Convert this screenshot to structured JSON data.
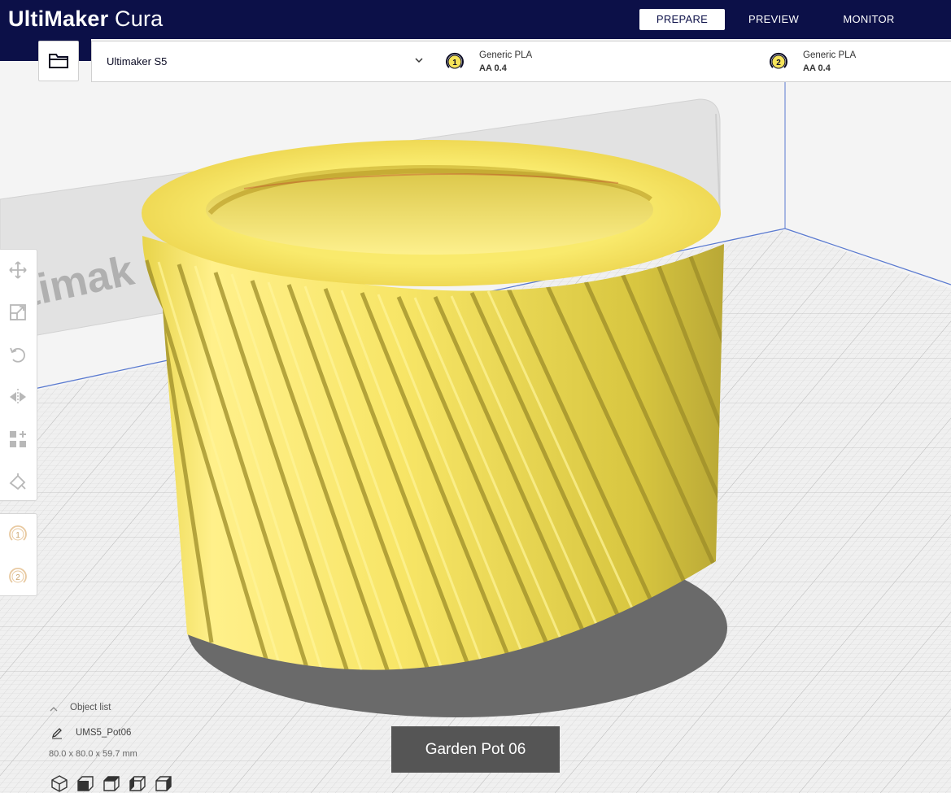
{
  "app": {
    "logo_bold": "UltiMaker",
    "logo_light": " Cura",
    "brand_color": "#0c1048"
  },
  "stages": {
    "prepare": "PREPARE",
    "preview": "PREVIEW",
    "monitor": "MONITOR",
    "active": "PREPARE"
  },
  "header": {
    "open_file_icon": "folder-icon",
    "printer": "Ultimaker S5",
    "extruders": [
      {
        "number": "1",
        "material": "Generic PLA",
        "core": "AA 0.4"
      },
      {
        "number": "2",
        "material": "Generic PLA",
        "core": "AA 0.4"
      }
    ]
  },
  "tools": [
    {
      "icon": "move-icon"
    },
    {
      "icon": "scale-icon"
    },
    {
      "icon": "rotate-icon"
    },
    {
      "icon": "mirror-icon"
    },
    {
      "icon": "per-model-settings-icon"
    },
    {
      "icon": "support-blocker-icon"
    }
  ],
  "extruder_tools": [
    "1",
    "2"
  ],
  "scene": {
    "buildplate_text": "ltimak",
    "model_color": "#f5e35a"
  },
  "object_list": {
    "header": "Object list",
    "object_name": "UMS5_Pot06",
    "dimensions": "80.0 x 80.0 x 59.7 mm"
  },
  "view_buttons": [
    "3d-view-icon",
    "front-view-icon",
    "top-view-icon",
    "left-view-icon",
    "right-view-icon"
  ],
  "tooltip": "Garden Pot 06"
}
